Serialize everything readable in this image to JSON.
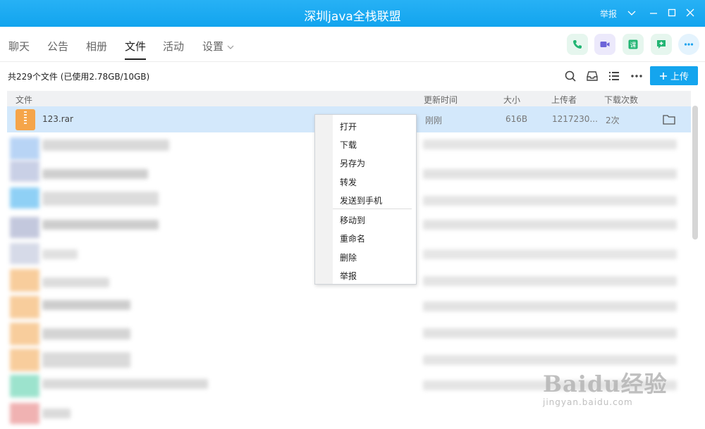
{
  "window": {
    "title": "深圳java全栈联盟",
    "report_label": "举报"
  },
  "tabs": [
    {
      "label": "聊天"
    },
    {
      "label": "公告"
    },
    {
      "label": "相册"
    },
    {
      "label": "文件",
      "active": true
    },
    {
      "label": "活动"
    },
    {
      "label": "设置"
    }
  ],
  "apps": [
    {
      "icon": "phone-icon",
      "color": "#22b573"
    },
    {
      "icon": "video-icon",
      "color": "#6c63d9"
    },
    {
      "icon": "course-icon",
      "color": "#22b573"
    },
    {
      "icon": "add-note-icon",
      "color": "#22b573"
    },
    {
      "icon": "more-icon",
      "color": "#1aa2ee"
    }
  ],
  "files": {
    "summary": "共229个文件 (已使用2.78GB/10GB)",
    "upload_label": "上传",
    "columns": {
      "name": "文件",
      "updated": "更新时间",
      "size": "大小",
      "uploader": "上传者",
      "downloads": "下载次数"
    },
    "rows": [
      {
        "name": "123.rar",
        "updated": "刚刚",
        "size": "616B",
        "uploader": "1217230...",
        "downloads": "2次"
      }
    ]
  },
  "context_menu": {
    "items": [
      "打开",
      "下载",
      "另存为",
      "转发",
      "发送到手机",
      "移动到",
      "重命名",
      "删除",
      "举报"
    ]
  },
  "watermark": {
    "brand": "Baidu经验",
    "url": "jingyan.baidu.com"
  },
  "colors": {
    "accent": "#14a5ee",
    "selected_row": "#d3e8fb",
    "file_icon": "#f5a54a"
  }
}
